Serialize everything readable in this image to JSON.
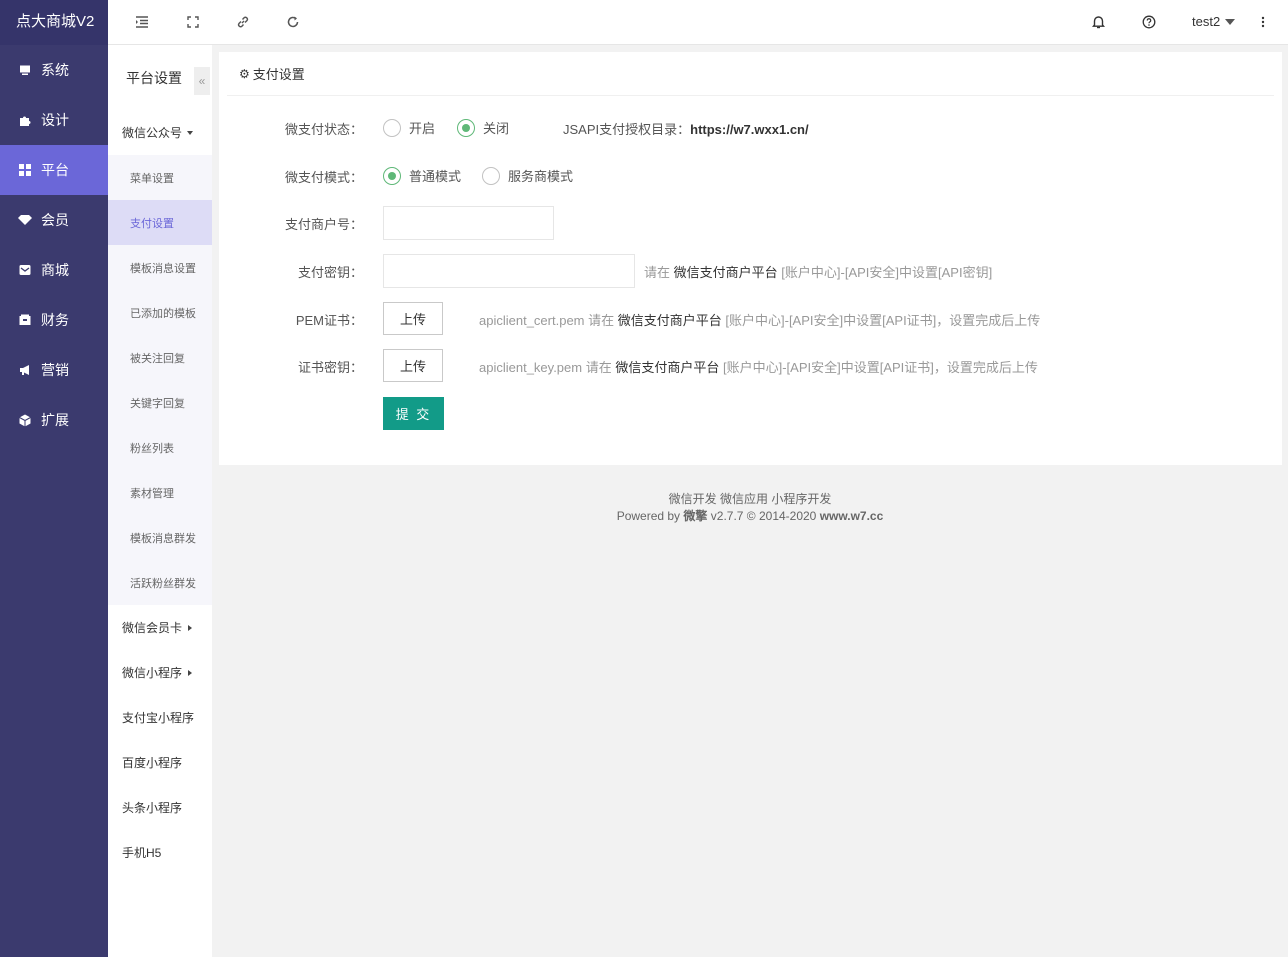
{
  "app": {
    "title": "点大商城V2"
  },
  "nav": [
    {
      "label": "系统",
      "icon": "monitor-icon"
    },
    {
      "label": "设计",
      "icon": "puzzle-icon"
    },
    {
      "label": "平台",
      "icon": "grid-icon",
      "active": true
    },
    {
      "label": "会员",
      "icon": "gem-icon"
    },
    {
      "label": "商城",
      "icon": "mail-icon"
    },
    {
      "label": "财务",
      "icon": "wallet-icon"
    },
    {
      "label": "营销",
      "icon": "megaphone-icon"
    },
    {
      "label": "扩展",
      "icon": "cube-icon"
    }
  ],
  "header": {
    "user": "test2"
  },
  "sub": {
    "title": "平台设置",
    "collapse": "«",
    "group1": "微信公众号",
    "items": [
      "菜单设置",
      "支付设置",
      "模板消息设置",
      "已添加的模板",
      "被关注回复",
      "关键字回复",
      "粉丝列表",
      "素材管理",
      "模板消息群发",
      "活跃粉丝群发"
    ],
    "groups": [
      "微信会员卡",
      "微信小程序",
      "支付宝小程序",
      "百度小程序",
      "头条小程序",
      "手机H5"
    ]
  },
  "card": {
    "title": "支付设置",
    "status_label": "微支付状态：",
    "status_on": "开启",
    "status_off": "关闭",
    "status_value": "关闭",
    "jsapi_label": "JSAPI支付授权目录：",
    "jsapi_url": "https://w7.wxx1.cn/",
    "mode_label": "微支付模式：",
    "mode_normal": "普通模式",
    "mode_service": "服务商模式",
    "mode_value": "普通模式",
    "merchant_label": "支付商户号：",
    "merchant_value": "",
    "key_label": "支付密钥：",
    "key_value": "",
    "key_hint_pre": "请在",
    "key_hint_link": "微信支付商户平台",
    "key_hint_post": "[账户中心]-[API安全]中设置[API密钥]",
    "pem_label": "PEM证书：",
    "upload": "上传",
    "pem_hint_pre": "apiclient_cert.pem 请在",
    "pem_hint_link": "微信支付商户平台",
    "pem_hint_post": "[账户中心]-[API安全]中设置[API证书]，设置完成后上传",
    "certkey_label": "证书密钥：",
    "certkey_hint_pre": "apiclient_key.pem 请在",
    "certkey_hint_link": "微信支付商户平台",
    "certkey_hint_post": "[账户中心]-[API安全]中设置[API证书]，设置完成后上传",
    "submit": "提 交"
  },
  "footer": {
    "links": "微信开发 微信应用 小程序开发",
    "powered_pre": "Powered by",
    "powered_brand": "微擎",
    "powered_post": "v2.7.7 © 2014-2020",
    "powered_site": "www.w7.cc"
  },
  "colors": {
    "sidebar": "#3b3a6e",
    "active": "#6b67d8",
    "submit": "#129b88",
    "radio": "#5fb878"
  }
}
